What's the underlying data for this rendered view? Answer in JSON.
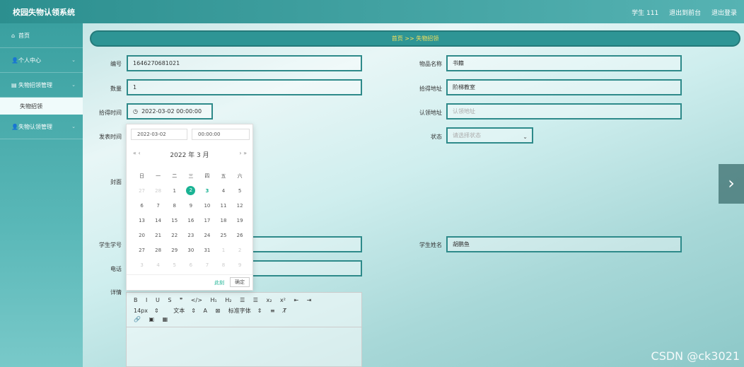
{
  "app": {
    "title": "校园失物认领系统"
  },
  "topbar": {
    "user": "学生 111",
    "back_admin": "退出到前台",
    "logout": "退出登录"
  },
  "sidebar": {
    "items": [
      {
        "label": "首页",
        "icon": "home-icon",
        "glyph": "⌂"
      },
      {
        "label": "个人中心",
        "icon": "user-icon",
        "glyph": "👤"
      },
      {
        "label": "失物招领管理",
        "icon": "briefcase-icon",
        "glyph": "▤"
      },
      {
        "label": "失物认领管理",
        "icon": "user-icon",
        "glyph": "👤"
      }
    ],
    "sub": "失物招领",
    "chevron": "⌄"
  },
  "breadcrumb": "首页 >> 失物招领",
  "form": {
    "number_label": "编号",
    "number_value": "1646270681021",
    "item_name_label": "物品名称",
    "item_name_value": "书籍",
    "qty_label": "数量",
    "qty_value": "1",
    "pickup_place_label": "拾得地址",
    "pickup_place_value": "阶梯教室",
    "pickup_time_label": "拾得时间",
    "pickup_time_value": "2022-03-02 00:00:00",
    "claim_place_label": "认领地址",
    "claim_place_placeholder": "认领地址",
    "publish_time_label": "发表时间",
    "status_label": "状态",
    "status_placeholder": "请选择状态",
    "cover_label": "封面",
    "student_no_label": "学生学号",
    "student_name_label": "学生姓名",
    "student_name_value": "胡鹏鱼",
    "phone_label": "电话",
    "detail_label": "详情"
  },
  "datepicker": {
    "date_input": "2022-03-02",
    "time_input": "00:00:00",
    "header": "2022 年  3 月",
    "prev": "«  ‹",
    "next": "›  »",
    "weekdays": [
      "日",
      "一",
      "二",
      "三",
      "四",
      "五",
      "六"
    ],
    "weeks": [
      [
        "27",
        "28",
        "1",
        "2",
        "3",
        "4",
        "5"
      ],
      [
        "6",
        "7",
        "8",
        "9",
        "10",
        "11",
        "12"
      ],
      [
        "13",
        "14",
        "15",
        "16",
        "17",
        "18",
        "19"
      ],
      [
        "20",
        "21",
        "22",
        "23",
        "24",
        "25",
        "26"
      ],
      [
        "27",
        "28",
        "29",
        "30",
        "31",
        "1",
        "2"
      ],
      [
        "3",
        "4",
        "5",
        "6",
        "7",
        "8",
        "9"
      ]
    ],
    "selected": "2",
    "now_label": "此刻",
    "ok_label": "确定"
  },
  "editor": {
    "row1": [
      "B",
      "I",
      "U",
      "S",
      "❞",
      "</>",
      "H₁",
      "H₂",
      "☰",
      "☰",
      "x₂",
      "x²",
      "⇤",
      "⇥"
    ],
    "font_size": "14px",
    "text_style": "文本",
    "font_family": "标准字体",
    "row3": [
      "🔗",
      "▣",
      "▦"
    ]
  },
  "watermark": "CSDN @ck3021",
  "icons": {
    "clock": "◷",
    "next": "›",
    "select": "⌄"
  },
  "colors": {
    "accent": "#2e8a8a",
    "highlight": "#1ab394"
  }
}
